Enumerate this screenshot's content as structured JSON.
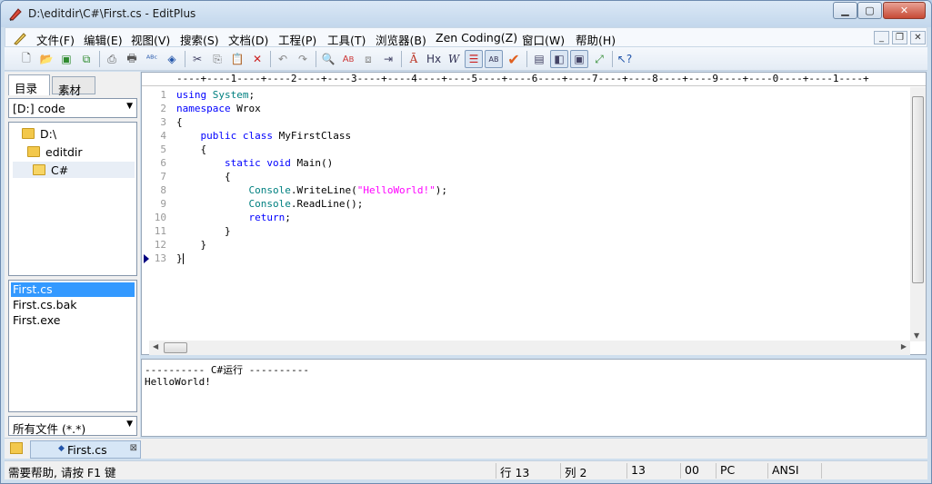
{
  "window": {
    "title": "D:\\editdir\\C#\\First.cs - EditPlus"
  },
  "menu": [
    "文件(F)",
    "编辑(E)",
    "视图(V)",
    "搜索(S)",
    "文档(D)",
    "工程(P)",
    "工具(T)",
    "浏览器(B)",
    "Zen Coding(Z)",
    "窗口(W)",
    "帮助(H)"
  ],
  "left_panel": {
    "tabs": [
      "目录",
      "素材"
    ],
    "drive": "[D:] code",
    "tree": [
      "D:\\",
      "editdir",
      "C#"
    ],
    "files": [
      "First.cs",
      "First.cs.bak",
      "First.exe"
    ],
    "file_filter": "所有文件 (*.*)"
  },
  "editor": {
    "ruler": "----+----1----+----2----+----3----+----4----+----5----+----6----+----7----+----8----+----9----+----0----+----1----+",
    "line_numbers": [
      "1",
      "2",
      "3",
      "4",
      "5",
      "6",
      "7",
      "8",
      "9",
      "10",
      "11",
      "12",
      "13"
    ]
  },
  "output": {
    "header": "---------- C#运行 ----------",
    "text": "HelloWorld!"
  },
  "doc_tab": {
    "label": "First.cs"
  },
  "status": {
    "help": "需要帮助, 请按 F1 键",
    "line": "行 13",
    "col": "列 2",
    "total": "13",
    "code": "00",
    "mode": "PC",
    "encoding": "ANSI"
  }
}
